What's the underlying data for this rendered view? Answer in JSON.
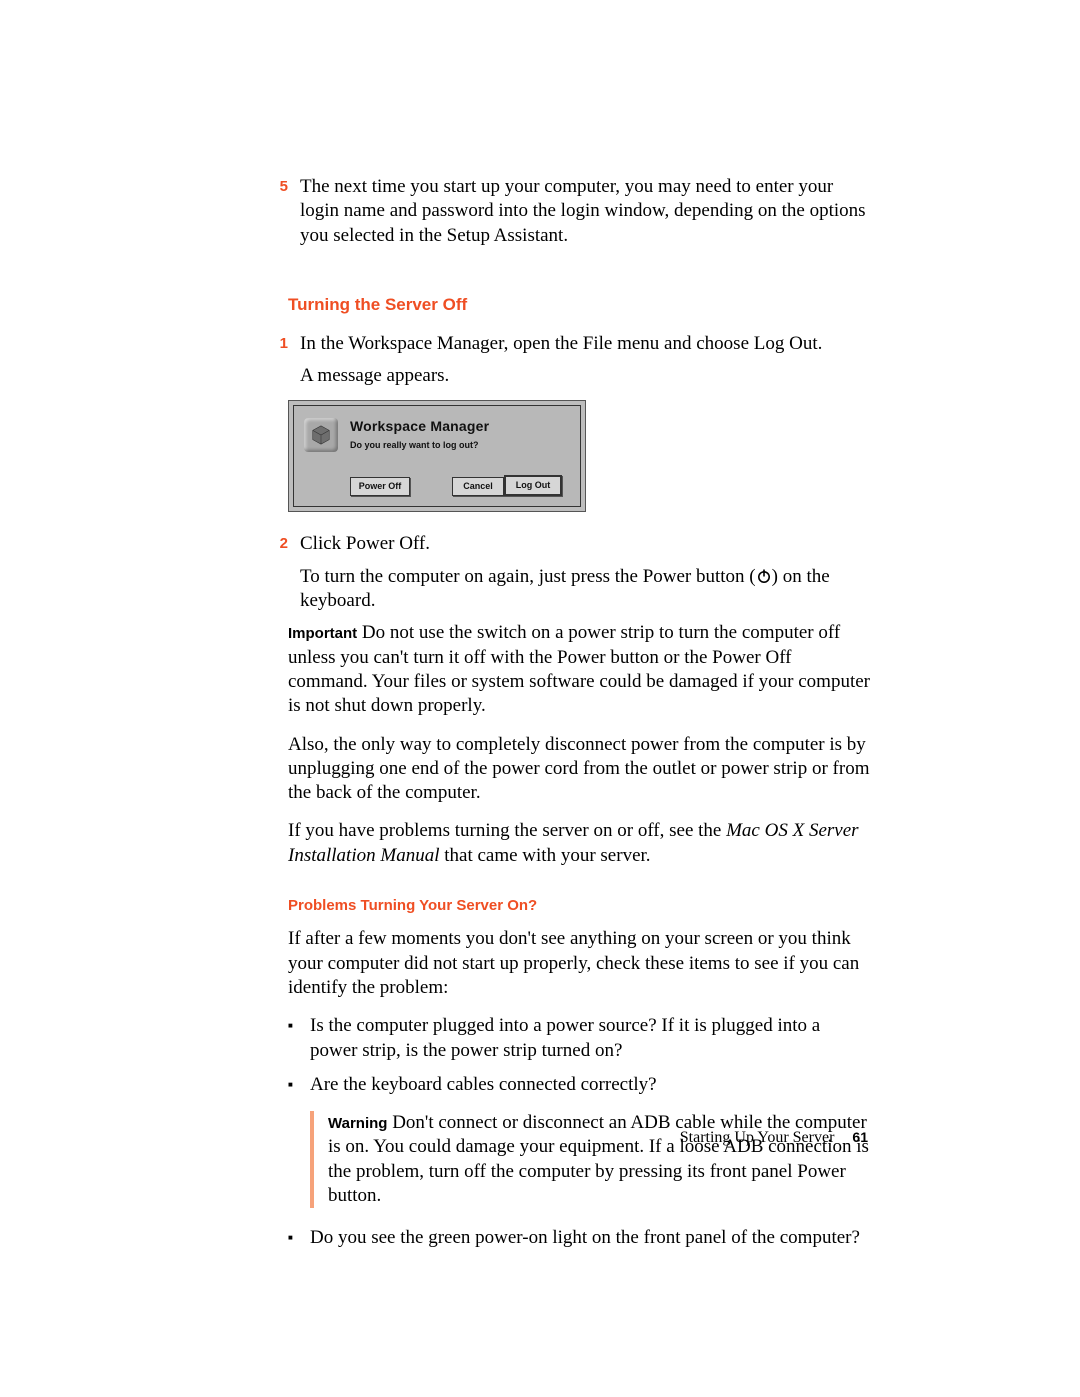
{
  "step5": {
    "num": "5",
    "text": "The next time you start up your computer, you may need to enter your login name and password into the login window, depending on the options you selected in the Setup Assistant."
  },
  "heading1": "Turning the Server Off",
  "step1": {
    "num": "1",
    "line1": "In the Workspace Manager, open the File menu and choose Log Out.",
    "line2": "A message appears."
  },
  "dialog": {
    "title": "Workspace Manager",
    "message": "Do you really want to log out?",
    "poweroff": "Power Off",
    "cancel": "Cancel",
    "logout": "Log Out"
  },
  "step2": {
    "num": "2",
    "line1": "Click Power Off.",
    "line2a": "To turn the computer on again, just press the Power button (",
    "line2b": ") on the keyboard."
  },
  "important": {
    "label": "Important",
    "text": "  Do not use the switch on a power strip to turn the computer off unless you can't turn it off with the Power button or the Power Off command. Your files or system software could be damaged if your computer is not shut down properly."
  },
  "para_also": "Also, the only way to completely disconnect power from the computer is by unplugging one end of the power cord from the outlet or power strip or from the back of the computer.",
  "para_problems_pre": "If you have problems turning the server on or off, see the ",
  "para_problems_ital": "Mac OS X Server Installation Manual",
  "para_problems_post": " that came with your server.",
  "heading2": "Problems Turning Your Server On?",
  "para_ifafter": "If after a few moments you don't see anything on your screen or you think your computer did not start up properly, check these items to see if you can identify the problem:",
  "b1": "Is the computer plugged into a power source? If it is plugged into a power strip, is the power strip turned on?",
  "b2": "Are the keyboard cables connected correctly?",
  "warning": {
    "label": "Warning",
    "text": "  Don't connect or disconnect an ADB cable while the computer is on. You could damage your equipment. If a loose ADB connection is the problem, turn off the computer by pressing its front panel Power button."
  },
  "b3": "Do you see the green power-on light on the front panel of the computer?",
  "footer_text": "Starting Up Your Server",
  "page_number": "61"
}
